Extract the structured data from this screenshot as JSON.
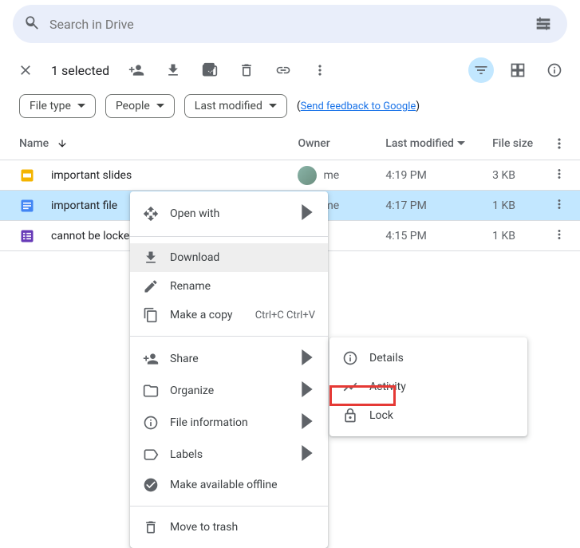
{
  "search": {
    "placeholder": "Search in Drive"
  },
  "selection": {
    "count_label": "1 selected"
  },
  "chips": {
    "filetype": "File type",
    "people": "People",
    "last_modified": "Last modified"
  },
  "feedback": {
    "label": "Send feedback to Google"
  },
  "columns": {
    "name": "Name",
    "owner": "Owner",
    "modified": "Last modified",
    "size": "File size"
  },
  "files": [
    {
      "name": "important slides",
      "owner": "me",
      "modified": "4:19 PM",
      "size": "3 KB"
    },
    {
      "name": "important file",
      "owner": "me",
      "modified": "4:17 PM",
      "size": "1 KB"
    },
    {
      "name": "cannot be locked - ",
      "owner": "",
      "modified": "4:15 PM",
      "size": "1 KB"
    }
  ],
  "context_menu": {
    "open_with": "Open with",
    "download": "Download",
    "rename": "Rename",
    "make_copy": "Make a copy",
    "make_copy_shortcut": "Ctrl+C Ctrl+V",
    "share": "Share",
    "organize": "Organize",
    "file_info": "File information",
    "labels": "Labels",
    "offline": "Make available offline",
    "trash": "Move to trash"
  },
  "submenu": {
    "details": "Details",
    "activity": "Activity",
    "lock": "Lock"
  }
}
